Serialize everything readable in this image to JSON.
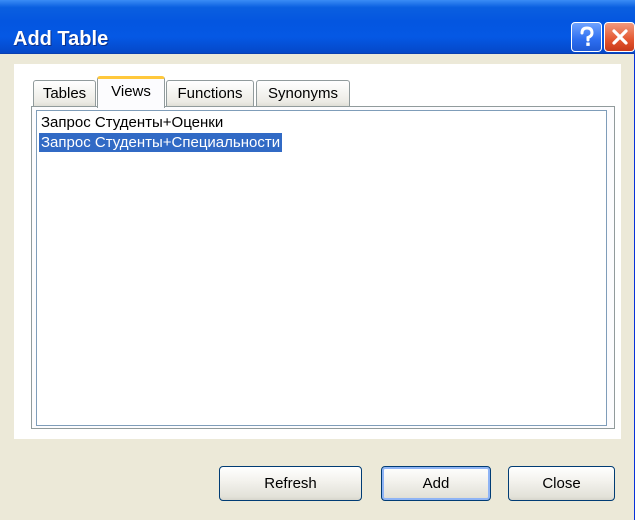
{
  "window": {
    "title": "Add Table"
  },
  "titlebar_buttons": {
    "help_icon": "question-mark-icon",
    "close_icon": "close-x-icon"
  },
  "tabs": [
    {
      "label": "Tables",
      "active": false
    },
    {
      "label": "Views",
      "active": true
    },
    {
      "label": "Functions",
      "active": false
    },
    {
      "label": "Synonyms",
      "active": false
    }
  ],
  "list": {
    "items": [
      {
        "label": "Запрос Студенты+Оценки",
        "selected": false
      },
      {
        "label": "Запрос Студенты+Специальности",
        "selected": true
      }
    ]
  },
  "buttons": {
    "refresh_label": "Refresh",
    "add_label": "Add",
    "close_label": "Close"
  },
  "colors": {
    "titlebar": "#0456e0",
    "selection": "#316ac5",
    "active_tab_accent": "#ffc83c",
    "window_bg": "#ece9d8"
  }
}
